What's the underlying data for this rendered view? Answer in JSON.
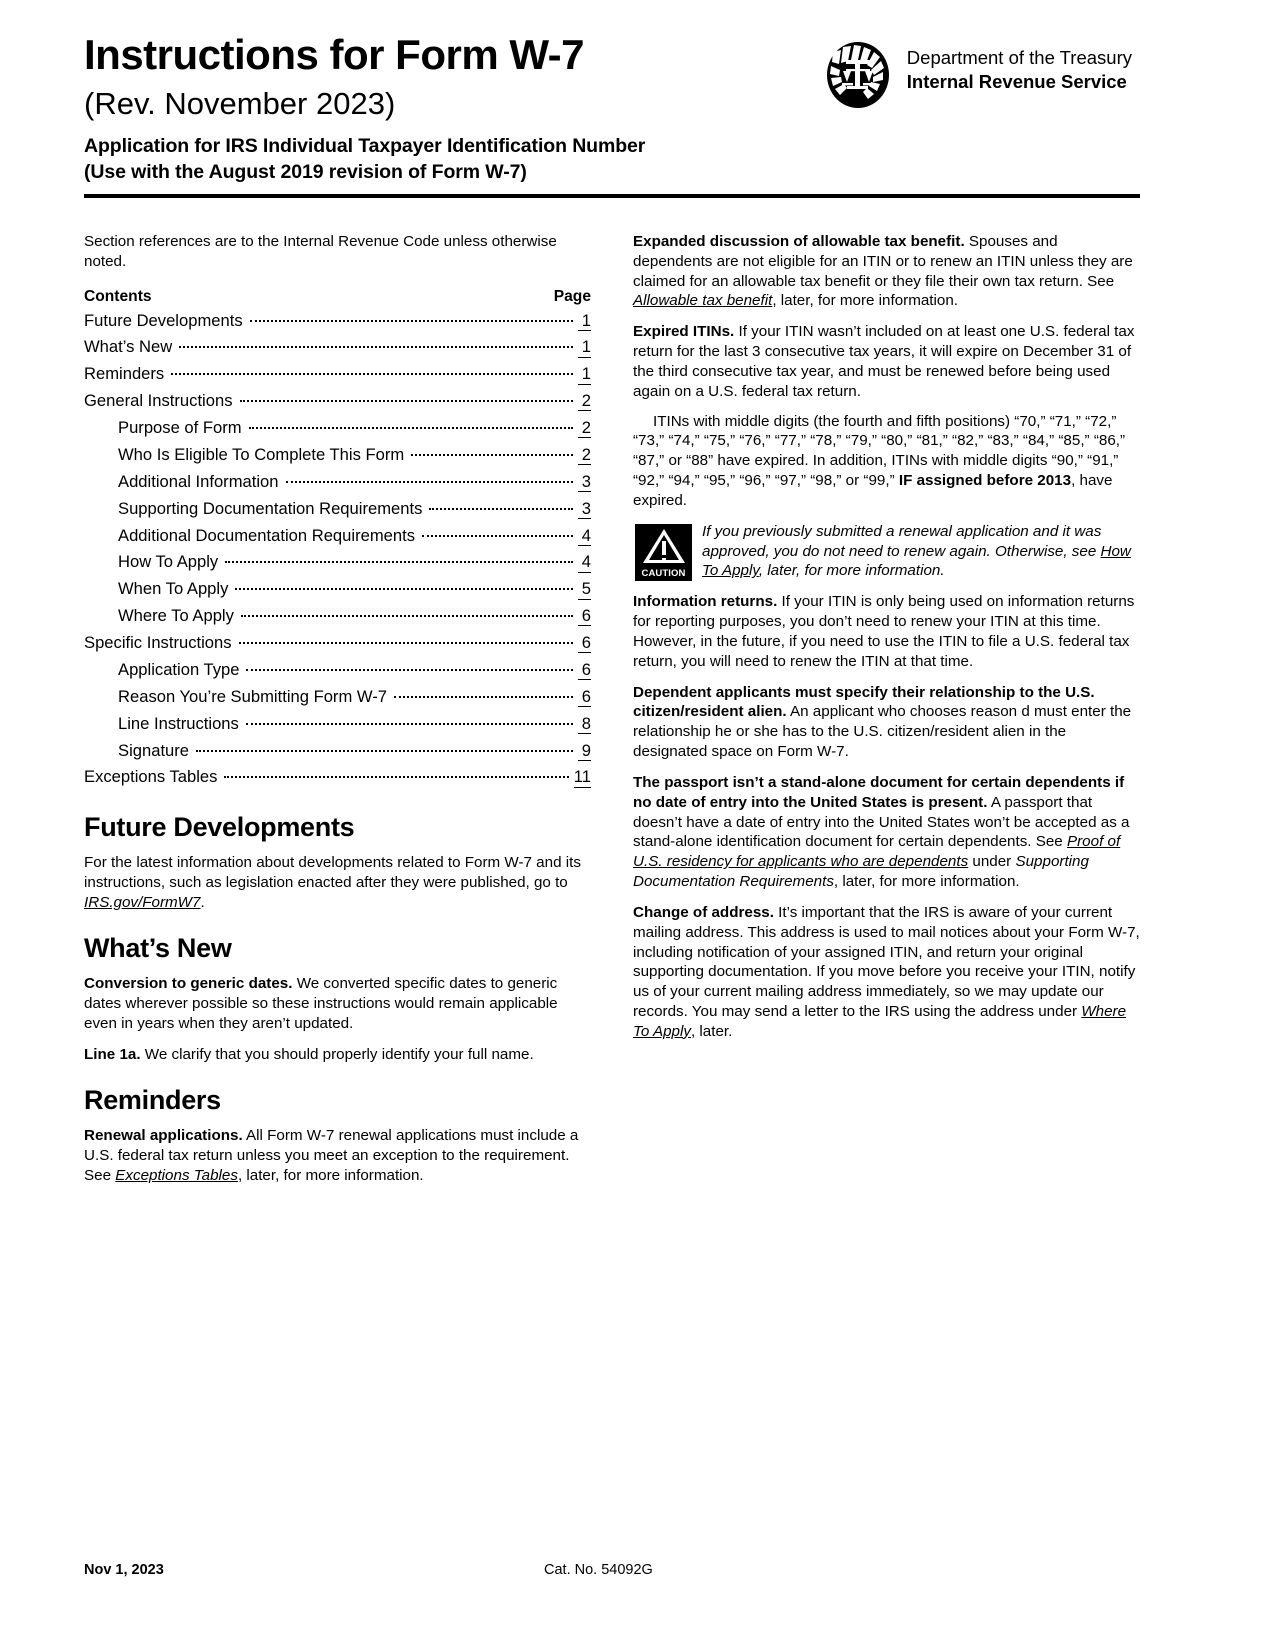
{
  "header": {
    "title": "Instructions for Form W-7",
    "revision": "(Rev. November 2023)",
    "subtitle_line1": "Application for IRS Individual Taxpayer Identification Number",
    "subtitle_line2": "(Use with the August 2019 revision of Form W-7)",
    "agency_department": "Department of the Treasury",
    "agency_service": "Internal Revenue Service",
    "seal_icon": "irs-eagle-scales-seal"
  },
  "left_column": {
    "intro_note": "Section references are to the Internal Revenue Code unless otherwise noted.",
    "toc": {
      "contents_label": "Contents",
      "page_label": "Page",
      "rows": [
        {
          "label": "Future Developments",
          "page": "1",
          "indent": false
        },
        {
          "label": "What’s New",
          "page": "1",
          "indent": false
        },
        {
          "label": "Reminders",
          "page": "1",
          "indent": false
        },
        {
          "label": "General Instructions",
          "page": "2",
          "indent": false
        },
        {
          "label": "Purpose of Form",
          "page": "2",
          "indent": true
        },
        {
          "label": "Who Is Eligible To Complete This Form",
          "page": "2",
          "indent": true
        },
        {
          "label": "Additional Information",
          "page": "3",
          "indent": true
        },
        {
          "label": "Supporting Documentation Requirements",
          "page": "3",
          "indent": true
        },
        {
          "label": "Additional Documentation Requirements",
          "page": "4",
          "indent": true
        },
        {
          "label": "How To Apply",
          "page": "4",
          "indent": true
        },
        {
          "label": "When To Apply",
          "page": "5",
          "indent": true
        },
        {
          "label": "Where To Apply",
          "page": "6",
          "indent": true
        },
        {
          "label": "Specific Instructions",
          "page": "6",
          "indent": false
        },
        {
          "label": "Application Type",
          "page": "6",
          "indent": true
        },
        {
          "label": "Reason You’re Submitting Form W-7",
          "page": "6",
          "indent": true
        },
        {
          "label": "Line Instructions",
          "page": "8",
          "indent": true
        },
        {
          "label": "Signature",
          "page": "9",
          "indent": true
        },
        {
          "label": "Exceptions Tables",
          "page": "11",
          "indent": false
        }
      ]
    },
    "future_developments": {
      "heading": "Future Developments",
      "text_before": "For the latest information about developments related to Form W-7 and its instructions, such as legislation enacted after they were published, go to ",
      "link": "IRS.gov/FormW7",
      "text_after": "."
    },
    "whats_new": {
      "heading": "What’s New",
      "paragraphs": [
        {
          "run_in": "Conversion to generic dates.",
          "text": " We converted specific dates to generic dates wherever possible so these instructions would remain applicable even in years when they aren’t updated."
        },
        {
          "run_in": "Line 1a.",
          "text": " We clarify that you should properly identify your full name."
        }
      ]
    },
    "reminders": {
      "heading": "Reminders",
      "run_in": "Renewal applications.",
      "text_before": " All Form W-7 renewal applications must include a U.S. federal tax return unless you meet an exception to the requirement. See ",
      "link": "Exceptions Tables",
      "text_after": ", later, for more information."
    }
  },
  "right_column": {
    "expanded_discussion": {
      "run_in": "Expanded discussion of allowable tax benefit.",
      "text_before": " Spouses and dependents are not eligible for an ITIN or to renew an ITIN unless they are claimed for an allowable tax benefit or they file their own tax return. See ",
      "link": "Allowable tax benefit",
      "text_after": ", later, for more information."
    },
    "expired_itins": {
      "run_in": "Expired ITINs.",
      "text": " If your ITIN wasn’t included on at least one U.S. federal tax return for the last 3 consecutive tax years, it will expire on December 31 of the third consecutive tax year, and must be renewed before being used again on a U.S. federal tax return."
    },
    "middle_digits_paragraph": {
      "text_before": "ITINs with middle digits (the fourth and fifth positions) “70,” “71,” “72,” “73,” “74,” “75,” “76,” “77,” “78,” “79,” “80,” “81,” “82,” “83,” “84,” “85,” “86,” “87,” or “88” have expired. In addition, ITINs with middle digits “90,” “91,” “92,” “94,” “95,” “96,” “97,” “98,” or “99,” ",
      "bold_part": "IF assigned before 2013",
      "text_after": ", have expired."
    },
    "caution": {
      "icon_name": "caution-icon",
      "icon_label": "CAUTION",
      "text_before": "If you previously submitted a renewal application and it was approved, you do not need to renew again. Otherwise, see ",
      "link": "How To Apply",
      "text_after": ", later, for more information."
    },
    "information_returns": {
      "run_in": "Information returns.",
      "text": " If your ITIN is only being used on information returns for reporting purposes, you don’t need to renew your ITIN at this time. However, in the future, if you need to use the ITIN to file a U.S. federal tax return, you will need to renew the ITIN at that time."
    },
    "dependent_applicants": {
      "run_in": "Dependent applicants must specify their relationship to the U.S. citizen/resident alien.",
      "text": " An applicant who chooses reason d must enter the relationship he or she has to the U.S. citizen/resident alien in the designated space on Form W-7."
    },
    "passport": {
      "run_in": "The passport isn’t a stand-alone document for certain dependents if no date of entry into the United States is present.",
      "text_before": " A passport that doesn’t have a date of entry into the United States won’t be accepted as a stand-alone identification document for certain dependents. See ",
      "link": "Proof of U.S. residency for applicants who are dependents",
      "text_middle": " under ",
      "italic_ref": "Supporting Documentation Requirements",
      "text_after": ", later, for more information."
    },
    "change_of_address": {
      "run_in": "Change of address.",
      "text_before": " It’s important that the IRS is aware of your current mailing address. This address is used to mail notices about your Form W-7, including notification of your assigned ITIN, and return your original supporting documentation. If you move before you receive your ITIN, notify us of your current mailing address immediately, so we may update our records. You may send a letter to the IRS using the address under ",
      "link": "Where To Apply",
      "text_after": ", later."
    }
  },
  "footer": {
    "date": "Nov 1, 2023",
    "catalog": "Cat. No. 54092G"
  }
}
